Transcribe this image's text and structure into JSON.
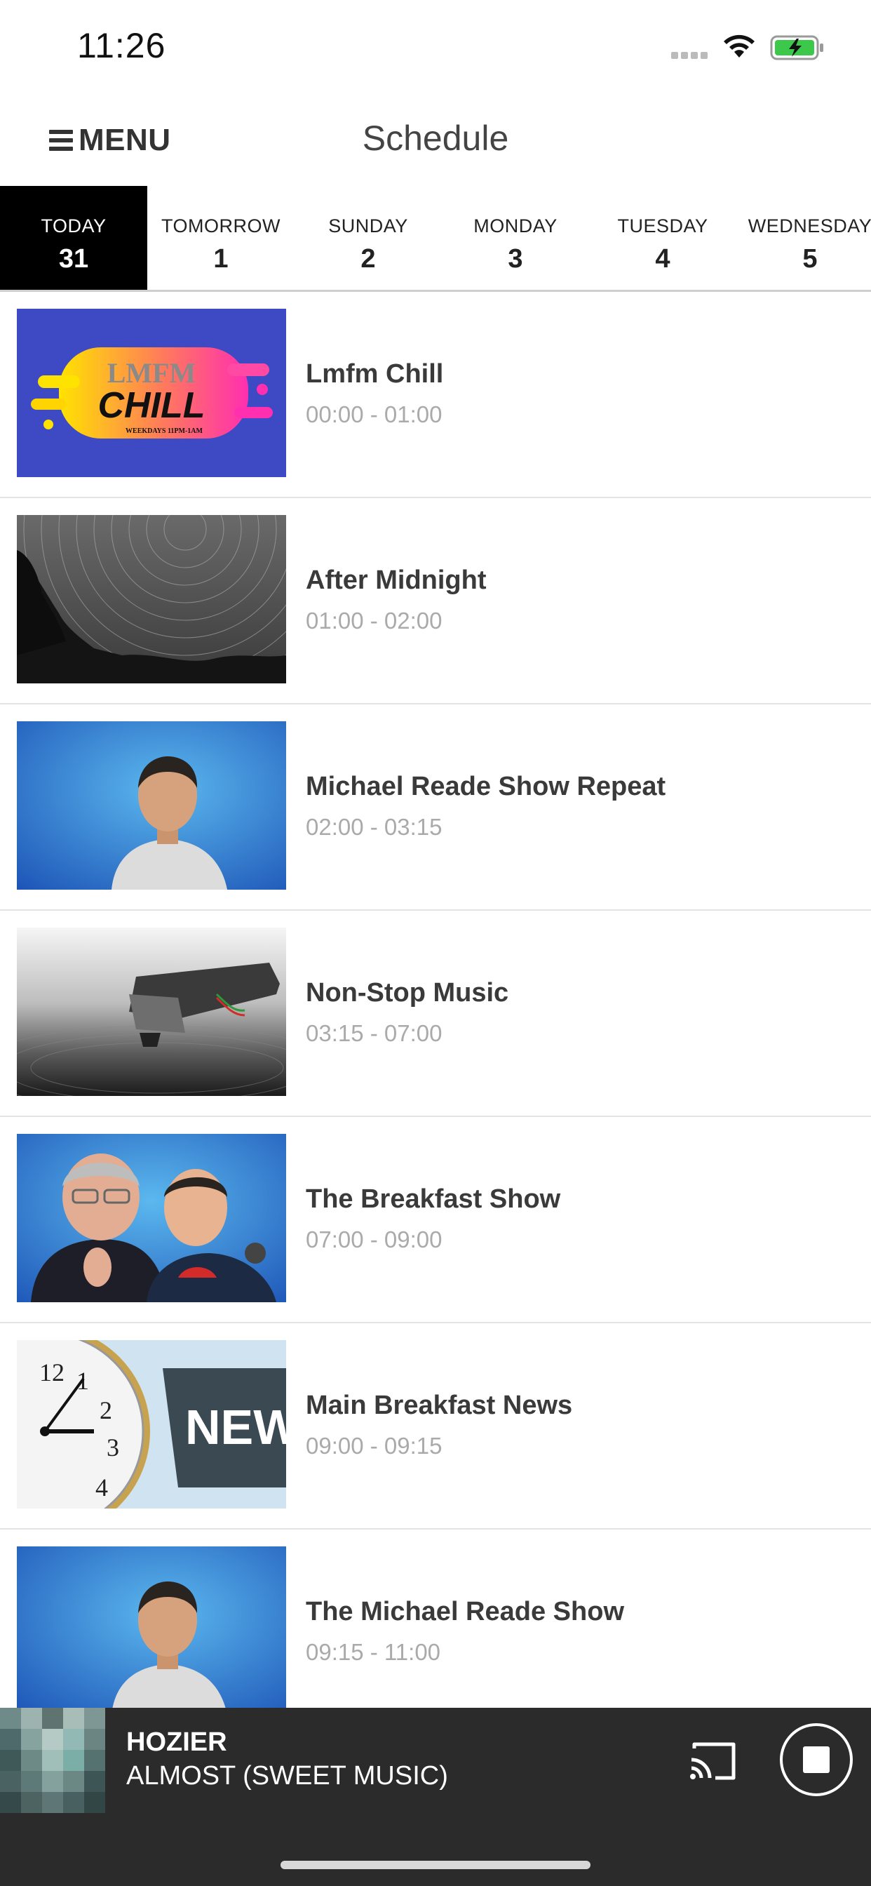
{
  "status_bar": {
    "time": "11:26"
  },
  "nav": {
    "menu_label": "MENU",
    "title": "Schedule"
  },
  "days": [
    {
      "name": "TODAY",
      "num": "31",
      "active": true
    },
    {
      "name": "TOMORROW",
      "num": "1"
    },
    {
      "name": "SUNDAY",
      "num": "2"
    },
    {
      "name": "MONDAY",
      "num": "3"
    },
    {
      "name": "TUESDAY",
      "num": "4"
    },
    {
      "name": "WEDNESDAY",
      "num": "5"
    }
  ],
  "shows": [
    {
      "title": "Lmfm Chill",
      "time": "00:00 - 01:00"
    },
    {
      "title": "After Midnight",
      "time": "01:00 - 02:00"
    },
    {
      "title": "Michael Reade Show Repeat",
      "time": "02:00 - 03:15"
    },
    {
      "title": "Non-Stop Music",
      "time": "03:15 - 07:00"
    },
    {
      "title": "The Breakfast Show",
      "time": "07:00 - 09:00"
    },
    {
      "title": "Main Breakfast News",
      "time": "09:00 - 09:15"
    },
    {
      "title": "The Michael Reade Show",
      "time": "09:15 - 11:00"
    }
  ],
  "thumbnails": {
    "chill": {
      "line1": "LMFM",
      "line2": "CHILL",
      "line3": "WEEKDAYS 11PM-1AM"
    },
    "news": {
      "label": "NEWS",
      "clock_numbers": [
        "12",
        "1",
        "2",
        "3",
        "4"
      ]
    }
  },
  "player": {
    "artist": "HOZIER",
    "track": "ALMOST (SWEET MUSIC)"
  },
  "icons": {
    "menu": "hamburger-icon",
    "cast": "cast-icon",
    "stop": "stop-icon",
    "wifi": "wifi-icon",
    "battery": "battery-charging-icon"
  },
  "colors": {
    "active_day_bg": "#000000",
    "player_bg": "#2b2b2b",
    "battery_green": "#3cc84a",
    "time_grey": "#aaaaaa"
  }
}
